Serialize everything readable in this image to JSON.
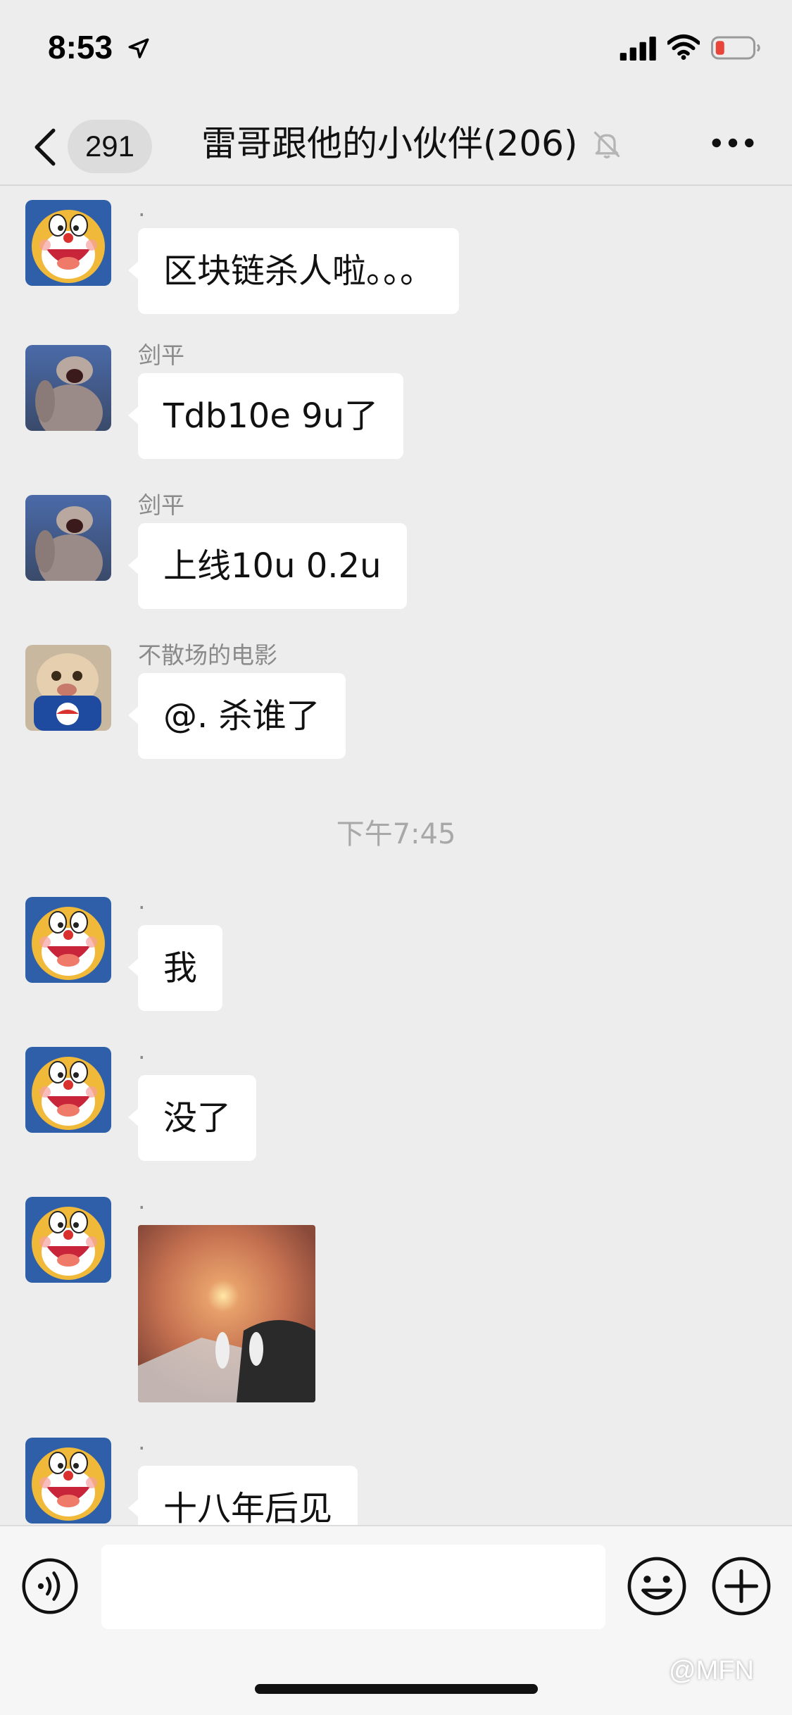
{
  "status_bar": {
    "time": "8:53",
    "icons": [
      "location-arrow-icon",
      "cellular-signal-icon",
      "wifi-icon",
      "battery-low-icon"
    ],
    "battery_color": "#e8443a"
  },
  "header": {
    "unread_count": "291",
    "title": "雷哥跟他的小伙伴(206)",
    "icons": [
      "chevron-left-icon",
      "mute-bell-icon",
      "more-dots-icon"
    ]
  },
  "messages": [
    {
      "sender": ".",
      "text": "区块链杀人啦。。。",
      "avatar": "doraemon-avatar"
    },
    {
      "sender": "剑平",
      "text": "Tdb10e  9u了",
      "avatar": "monkey-avatar"
    },
    {
      "sender": "剑平",
      "text": "上线10u 0.2u",
      "avatar": "monkey-avatar"
    },
    {
      "sender": "不散场的电影",
      "text": "@. 杀谁了",
      "avatar": "cat-avatar"
    },
    {
      "sender": ".",
      "text": "我",
      "avatar": "doraemon-avatar"
    },
    {
      "sender": ".",
      "text": "没了",
      "avatar": "doraemon-avatar"
    },
    {
      "sender": ".",
      "text": "",
      "avatar": "doraemon-avatar",
      "image": "photo-message"
    },
    {
      "sender": ".",
      "text": "十八年后见",
      "avatar": "doraemon-avatar"
    }
  ],
  "time_separator": "下午7:45",
  "input_bar": {
    "placeholder": "",
    "icons": [
      "voice-icon",
      "emoji-icon",
      "plus-icon"
    ]
  },
  "watermark": "@MFN",
  "colors": {
    "background": "#ededed",
    "bubble": "#ffffff",
    "sender_text": "#8a8a8a"
  }
}
